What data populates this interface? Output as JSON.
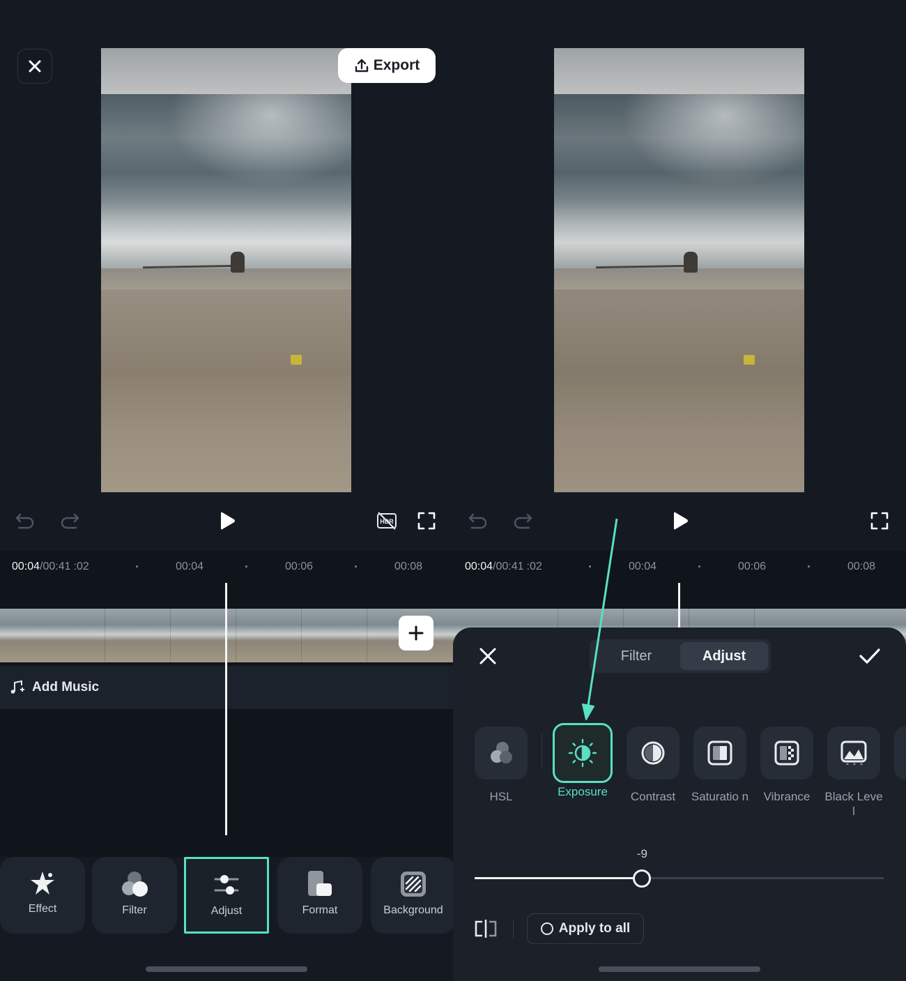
{
  "left": {
    "export_label": "Export",
    "time": {
      "current": "00:04",
      "total": "/00:41",
      "partial": ":02",
      "ticks": [
        "00:04",
        "00:06",
        "00:08"
      ]
    },
    "add_music_label": "Add Music",
    "toolbar": [
      {
        "label": "Effect",
        "icon": "star-effect-icon"
      },
      {
        "label": "Filter",
        "icon": "filter-circles-icon"
      },
      {
        "label": "Adjust",
        "icon": "sliders-icon",
        "selected": true
      },
      {
        "label": "Format",
        "icon": "format-icon"
      },
      {
        "label": "Background",
        "icon": "background-icon"
      }
    ]
  },
  "right": {
    "time": {
      "current": "00:04",
      "total": "/00:41",
      "partial": ":02",
      "ticks": [
        "00:04",
        "00:06",
        "00:08"
      ]
    },
    "tabs": [
      {
        "label": "Filter",
        "active": false
      },
      {
        "label": "Adjust",
        "active": true
      }
    ],
    "adjust_tools": [
      {
        "label": "HSL",
        "icon": "hsl-icon"
      },
      {
        "label": "Exposure",
        "icon": "exposure-icon",
        "active": true
      },
      {
        "label": "Contrast",
        "icon": "contrast-icon"
      },
      {
        "label": "Saturatio n",
        "icon": "saturation-icon"
      },
      {
        "label": "Vibrance",
        "icon": "vibrance-icon"
      },
      {
        "label": "Black Level",
        "icon": "black-level-icon"
      }
    ],
    "slider": {
      "value_label": "-9",
      "value": -9,
      "min": -100,
      "max": 100
    },
    "apply_all_label": "Apply to all"
  },
  "colors": {
    "accent": "#59e0c2",
    "background": "#151a22",
    "panel": "#1b2029"
  }
}
